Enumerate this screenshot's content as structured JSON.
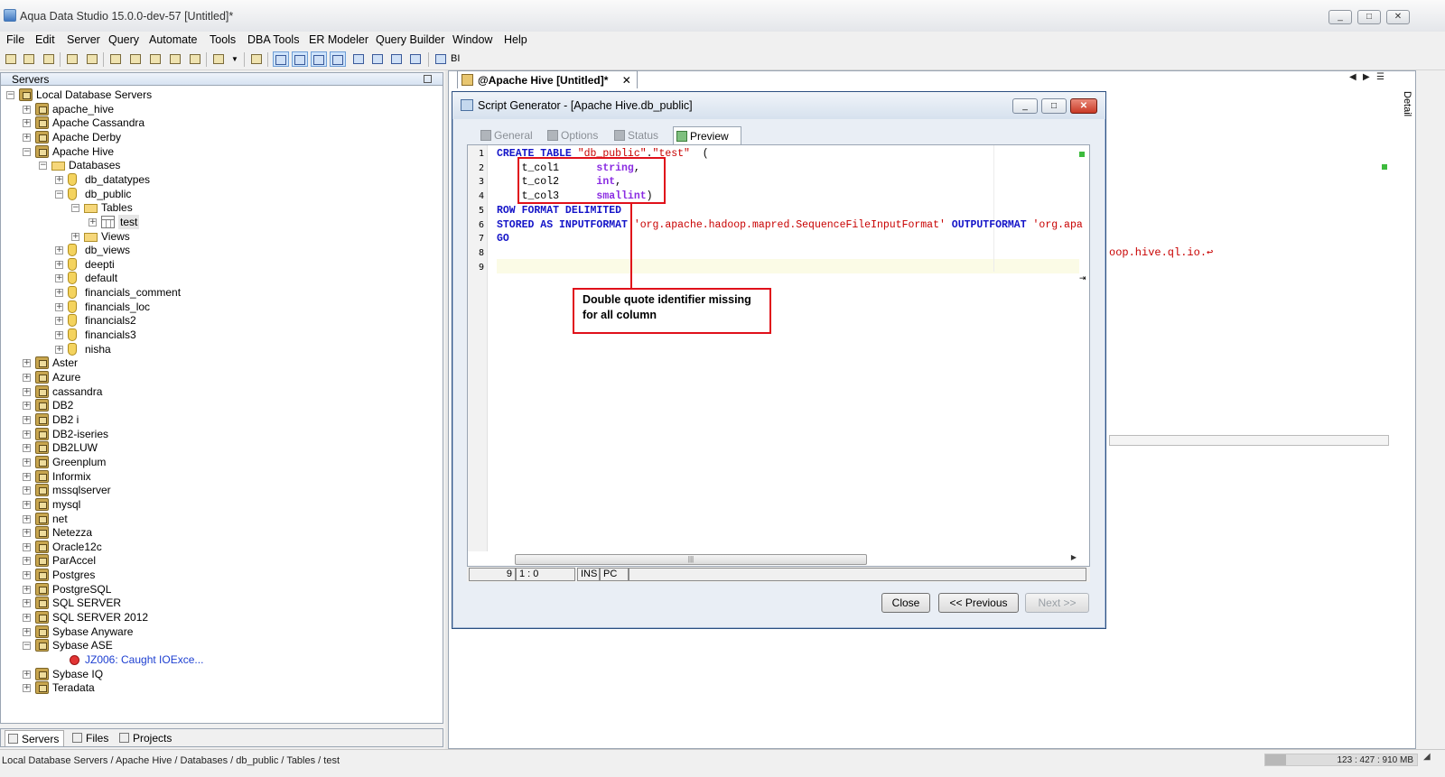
{
  "window": {
    "title": "Aqua Data Studio 15.0.0-dev-57 [Untitled]*",
    "controls": [
      "_",
      "□",
      "✕"
    ]
  },
  "menu": [
    "File",
    "Edit",
    "Server",
    "Query",
    "Automate",
    "Tools",
    "DBA Tools",
    "ER Modeler",
    "Query Builder",
    "Window",
    "Help"
  ],
  "toolbar": {
    "bi_label": "BI"
  },
  "servers_panel": {
    "title": "Servers",
    "tree": [
      {
        "label": "Local Database Servers",
        "kind": "root"
      },
      {
        "label": "apache_hive",
        "kind": "server"
      },
      {
        "label": "Apache Cassandra",
        "kind": "server"
      },
      {
        "label": "Apache Derby",
        "kind": "server"
      },
      {
        "label": "Apache Hive",
        "kind": "server",
        "expanded": true
      },
      {
        "label": "Databases",
        "kind": "folder"
      },
      {
        "label": "db_datatypes",
        "kind": "db"
      },
      {
        "label": "db_public",
        "kind": "db"
      },
      {
        "label": "Tables",
        "kind": "folder"
      },
      {
        "label": "test",
        "kind": "table",
        "selected": true
      },
      {
        "label": "Views",
        "kind": "folder"
      },
      {
        "label": "db_views",
        "kind": "db"
      },
      {
        "label": "deepti",
        "kind": "db"
      },
      {
        "label": "default",
        "kind": "db"
      },
      {
        "label": "financials_comment",
        "kind": "db"
      },
      {
        "label": "financials_loc",
        "kind": "db"
      },
      {
        "label": "financials2",
        "kind": "db"
      },
      {
        "label": "financials3",
        "kind": "db"
      },
      {
        "label": "nisha",
        "kind": "db"
      },
      {
        "label": "Aster",
        "kind": "server"
      },
      {
        "label": "Azure",
        "kind": "server"
      },
      {
        "label": "cassandra",
        "kind": "server"
      },
      {
        "label": "DB2",
        "kind": "server"
      },
      {
        "label": "DB2 i",
        "kind": "server"
      },
      {
        "label": "DB2-iseries",
        "kind": "server"
      },
      {
        "label": "DB2LUW",
        "kind": "server"
      },
      {
        "label": "Greenplum",
        "kind": "server"
      },
      {
        "label": "Informix",
        "kind": "server"
      },
      {
        "label": "mssqlserver",
        "kind": "server"
      },
      {
        "label": "mysql",
        "kind": "server"
      },
      {
        "label": "net",
        "kind": "server"
      },
      {
        "label": "Netezza",
        "kind": "server"
      },
      {
        "label": "Oracle12c",
        "kind": "server"
      },
      {
        "label": "ParAccel",
        "kind": "server"
      },
      {
        "label": "Postgres",
        "kind": "server"
      },
      {
        "label": "PostgreSQL",
        "kind": "server"
      },
      {
        "label": "SQL SERVER",
        "kind": "server"
      },
      {
        "label": "SQL SERVER 2012",
        "kind": "server"
      },
      {
        "label": "Sybase Anyware",
        "kind": "server"
      },
      {
        "label": "Sybase ASE",
        "kind": "server"
      },
      {
        "label": "JZ006: Caught IOExce...",
        "kind": "error"
      },
      {
        "label": "Sybase IQ",
        "kind": "server"
      },
      {
        "label": "Teradata",
        "kind": "server"
      }
    ],
    "bottom_tabs": [
      "Servers",
      "Files",
      "Projects"
    ]
  },
  "status_bar": {
    "path": "Local Database Servers / Apache Hive / Databases / db_public / Tables / test",
    "memory": "123 : 427 : 910 MB",
    "memory_used_fraction": 0.135
  },
  "document_tab": {
    "label": "@Apache Hive [Untitled]*",
    "close": "✕"
  },
  "detail_tab": "Detail",
  "background_editor": {
    "code_fragment": "oop.hive.ql.io.↩"
  },
  "dialog": {
    "title": "Script Generator - [Apache Hive.db_public]",
    "tabs": [
      "General",
      "Options",
      "Status",
      "Preview"
    ],
    "active_tab": "Preview",
    "code_lines": [
      {
        "n": "1",
        "parts": [
          {
            "t": "CREATE TABLE ",
            "c": "kw"
          },
          {
            "t": "\"db_public\"",
            "c": "str"
          },
          {
            "t": ".",
            "c": ""
          },
          {
            "t": "\"test\"",
            "c": "str"
          },
          {
            "t": "  (",
            "c": ""
          }
        ]
      },
      {
        "n": "2",
        "parts": [
          {
            "t": "    t_col1      ",
            "c": ""
          },
          {
            "t": "string",
            "c": "typ"
          },
          {
            "t": ",",
            "c": ""
          }
        ]
      },
      {
        "n": "3",
        "parts": [
          {
            "t": "    t_col2      ",
            "c": ""
          },
          {
            "t": "int",
            "c": "typ"
          },
          {
            "t": ",",
            "c": ""
          }
        ]
      },
      {
        "n": "4",
        "parts": [
          {
            "t": "    t_col3      ",
            "c": ""
          },
          {
            "t": "smallint",
            "c": "typ"
          },
          {
            "t": ")",
            "c": ""
          }
        ]
      },
      {
        "n": "5",
        "parts": [
          {
            "t": "ROW FORMAT DELIMITED",
            "c": "kw"
          }
        ]
      },
      {
        "n": "6",
        "parts": [
          {
            "t": "STORED AS INPUTFORMAT ",
            "c": "kw"
          },
          {
            "t": "'org.apache.hadoop.mapred.SequenceFileInputFormat'",
            "c": "str"
          },
          {
            "t": " ",
            "c": ""
          },
          {
            "t": "OUTPUTFORMAT",
            "c": "kw"
          },
          {
            "t": " ",
            "c": ""
          },
          {
            "t": "'org.apa",
            "c": "str"
          }
        ]
      },
      {
        "n": "7",
        "parts": [
          {
            "t": "GO",
            "c": "kw"
          }
        ]
      },
      {
        "n": "8",
        "parts": []
      },
      {
        "n": "9",
        "parts": []
      }
    ],
    "editor_status": {
      "line": "9",
      "position": "1 : 0",
      "mode": "INS",
      "encoding": "PC"
    },
    "buttons": {
      "close": "Close",
      "previous": "<< Previous",
      "next": "Next >>"
    }
  },
  "annotation": {
    "text_line1": "Double quote identifier missing",
    "text_line2": "for all column"
  }
}
